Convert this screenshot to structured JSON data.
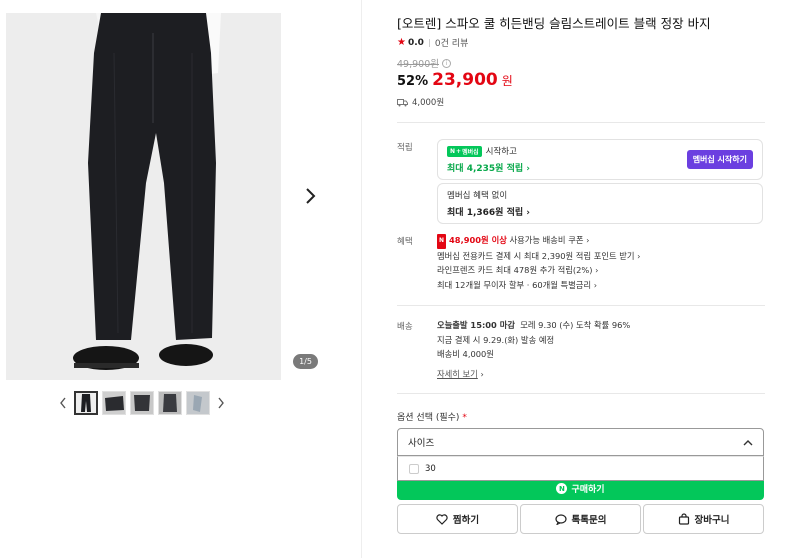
{
  "gallery": {
    "page_indicator": "1/5",
    "thumbnail_count": 5
  },
  "product": {
    "title": "[오트렌] 스파오 쿨 히든밴딩 슬림스트레이트 블랙 정장 바지",
    "rating": "0.0",
    "reviews": "0건 리뷰",
    "original_price": "49,900원",
    "discount": "52%",
    "sale_price": "23,900",
    "sale_unit": "원",
    "shipping_fee": "4,000원"
  },
  "reward": {
    "label": "적립",
    "member_badge": "멤버십",
    "member_start_text": "시작하고",
    "member_max": "최대 4,235원 적립",
    "member_button": "멤버십 시작하기",
    "nonmember_text": "멤버십 혜택 없이",
    "nonmember_max": "최대 1,366원 적립"
  },
  "benefits": {
    "label": "혜택",
    "coupon_badge": "N",
    "coupon_highlight": "48,900원 이상",
    "coupon_text": "사용가능 배송비 쿠폰",
    "line2": "멤버십 전용카드 결제 시 최대 2,390원 적립 포인트 받기",
    "line3": "라인프렌즈 카드 최대 478원 추가 적립(2%)",
    "line4": "최대 12개월 무이자 할부 · 60개월 특별금리"
  },
  "delivery": {
    "label": "배송",
    "today_ship": "오늘출발 15:00 마감",
    "arrival": "모레 9.30 (수) 도착 확률 96%",
    "pay_now": "지금 결제 시 9.29.(화) 발송 예정",
    "fee": "배송비 4,000원",
    "details_link": "자세히 보기"
  },
  "options": {
    "label": "옵션 선택 (필수)",
    "required_mark": "*",
    "select_value": "사이즈",
    "dropdown_item": "30",
    "buy_button": "구매하기"
  },
  "actions": {
    "wish": "찜하기",
    "talk": "톡톡문의",
    "cart": "장바구니"
  },
  "colors": {
    "accent_red": "#e30613",
    "naver_green": "#03c75a",
    "membership_purple": "#6b3fe0"
  }
}
